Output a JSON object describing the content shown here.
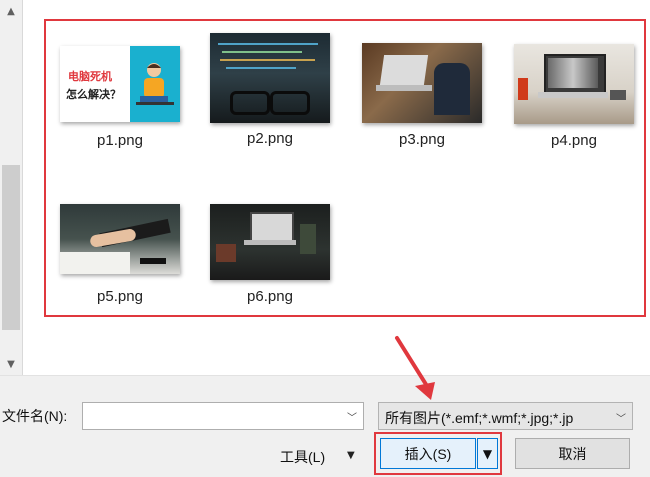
{
  "files": [
    {
      "name": "p1.png",
      "thumb_text_line1": "电脑死机",
      "thumb_text_line2": "怎么解决？"
    },
    {
      "name": "p2.png"
    },
    {
      "name": "p3.png"
    },
    {
      "name": "p4.png"
    },
    {
      "name": "p5.png"
    },
    {
      "name": "p6.png"
    }
  ],
  "footer": {
    "filename_label": "文件名(N):",
    "filename_value": "",
    "filter_value": "所有图片(*.emf;*.wmf;*.jpg;*.jp",
    "tools_label": "工具(L)",
    "insert_label": "插入(S)",
    "cancel_label": "取消"
  },
  "colors": {
    "highlight": "#e0383e",
    "accent_border": "#0078d7"
  }
}
